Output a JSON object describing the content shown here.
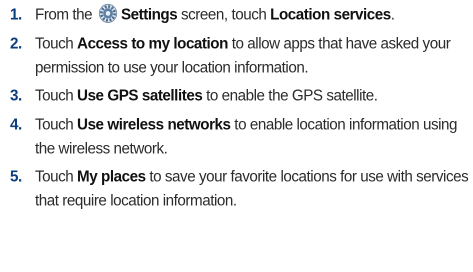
{
  "steps": [
    {
      "number": "1.",
      "before": "From the ",
      "icon": "settings-gear-icon",
      "bold1": "Settings",
      "middle": " screen, touch ",
      "bold2": "Location services",
      "after": "."
    },
    {
      "number": "2.",
      "before": "Touch ",
      "bold1": "Access to my location",
      "after": " to allow apps that have asked your permission to use your location information."
    },
    {
      "number": "3.",
      "before": "Touch ",
      "bold1": "Use GPS satellites",
      "after": " to enable the GPS satellite."
    },
    {
      "number": "4.",
      "before": "Touch ",
      "bold1": "Use wireless networks",
      "after": " to enable location information using the wireless network."
    },
    {
      "number": "5.",
      "before": "Touch ",
      "bold1": "My places",
      "after": " to save your favorite locations for use with services that require location information."
    }
  ],
  "colors": {
    "number": "#0a3d7c",
    "text": "#2b2b2b",
    "icon": "#4a6d8f"
  }
}
